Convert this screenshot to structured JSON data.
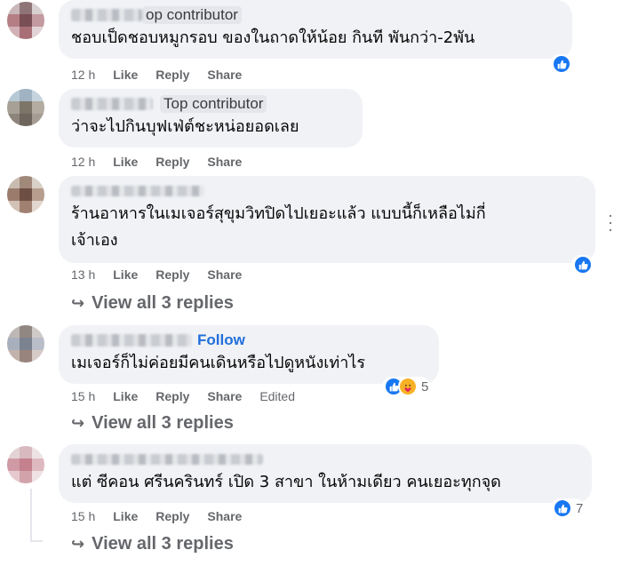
{
  "comments": [
    {
      "badge": "op contributor",
      "text_lines": [
        "ชอบเป็ดชอบหมูกรอบ ของในถาดให้น้อย กินที พันกว่า-2พัน"
      ],
      "time": "12 h",
      "like": "Like",
      "reply": "Reply",
      "share": "Share",
      "reactions": {
        "types": [
          "like"
        ],
        "count": ""
      }
    },
    {
      "badge": "Top contributor",
      "text_lines": [
        "ว่าจะไปกินบุฟเฟ่ต์ชะหน่อยอดเลย"
      ],
      "time": "12 h",
      "like": "Like",
      "reply": "Reply",
      "share": "Share"
    },
    {
      "text_lines": [
        "ร้านอาหารในเมเจอร์สุขุมวิทปิดไปเยอะแล้ว แบบนี้ก็เหลือไม่กี่",
        "เจ้าเอง"
      ],
      "time": "13 h",
      "like": "Like",
      "reply": "Reply",
      "share": "Share",
      "reactions": {
        "types": [
          "like"
        ],
        "count": ""
      },
      "view_replies": "View all 3 replies"
    },
    {
      "follow": "Follow",
      "text_lines": [
        "เมเจอร์ก็ไม่ค่อยมีคนเดินหรือไปดูหนังเท่าไร"
      ],
      "time": "15 h",
      "like": "Like",
      "reply": "Reply",
      "share": "Share",
      "edited": "Edited",
      "reactions": {
        "types": [
          "like",
          "care"
        ],
        "count": "5"
      },
      "view_replies": "View all 3 replies"
    },
    {
      "text_lines": [
        "แต่ ซีคอน ศรีนครินทร์ เปิด 3 สาขา ในห้ามเดียว คนเยอะทุกจุด"
      ],
      "time": "15 h",
      "like": "Like",
      "reply": "Reply",
      "share": "Share",
      "reactions": {
        "types": [
          "like"
        ],
        "count": "7"
      },
      "view_replies": "View all 3 replies"
    }
  ],
  "colors": {
    "bubble": "#f0f2f5",
    "meta_text": "#65676b",
    "like_blue": "#1877f2",
    "follow_blue": "#216fdb"
  },
  "icons": [
    "like-icon",
    "care-icon",
    "reply-arrow-icon",
    "more-options-icon"
  ]
}
